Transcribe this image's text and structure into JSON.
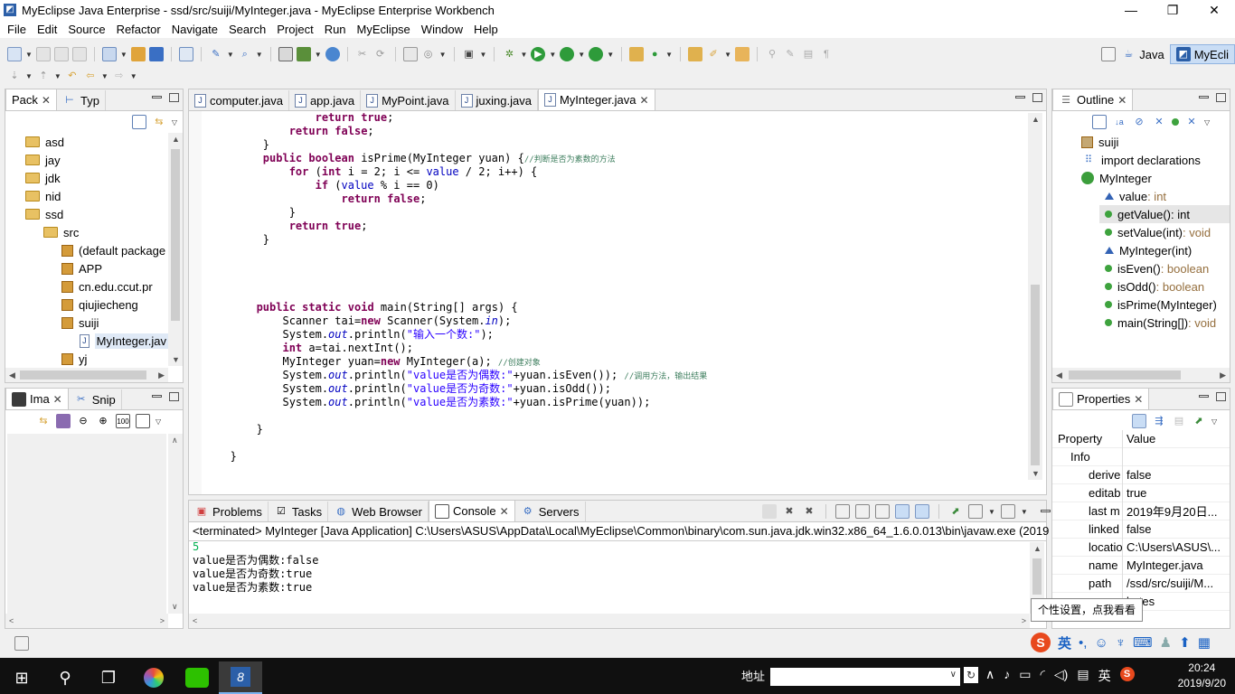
{
  "window": {
    "title": "MyEclipse Java Enterprise - ssd/src/suiji/MyInteger.java - MyEclipse Enterprise Workbench",
    "minimize": "—",
    "maximize": "❐",
    "close": "✕"
  },
  "menu": [
    "File",
    "Edit",
    "Source",
    "Refactor",
    "Navigate",
    "Search",
    "Project",
    "Run",
    "MyEclipse",
    "Window",
    "Help"
  ],
  "perspectives": [
    {
      "label": "Java",
      "active": false
    },
    {
      "label": "MyEcli",
      "active": true
    }
  ],
  "package_explorer": {
    "tabs": [
      {
        "label": "Pack",
        "active": true
      },
      {
        "label": "Typ",
        "active": false
      }
    ],
    "tree": [
      {
        "label": "asd",
        "indent": 0,
        "icon": "folder-icon"
      },
      {
        "label": "jay",
        "indent": 0,
        "icon": "folder-icon"
      },
      {
        "label": "jdk",
        "indent": 0,
        "icon": "folder-icon"
      },
      {
        "label": "nid",
        "indent": 0,
        "icon": "folder-icon"
      },
      {
        "label": "ssd",
        "indent": 0,
        "icon": "folder-icon"
      },
      {
        "label": "src",
        "indent": 1,
        "icon": "folder-icon"
      },
      {
        "label": "(default package",
        "indent": 2,
        "icon": "package-icon"
      },
      {
        "label": "APP",
        "indent": 2,
        "icon": "package-icon"
      },
      {
        "label": "cn.edu.ccut.pr",
        "indent": 2,
        "icon": "package-icon"
      },
      {
        "label": "qiujiecheng",
        "indent": 2,
        "icon": "package-icon"
      },
      {
        "label": "suiji",
        "indent": 2,
        "icon": "package-icon"
      },
      {
        "label": "MyInteger.jav",
        "indent": 3,
        "icon": "java-file-icon",
        "selected": true
      },
      {
        "label": "yj",
        "indent": 2,
        "icon": "package-icon"
      }
    ]
  },
  "image_view": {
    "tabs": [
      {
        "label": "Ima",
        "active": true
      },
      {
        "label": "Snip",
        "active": false
      }
    ]
  },
  "editor": {
    "tabs": [
      {
        "label": "computer.java",
        "active": false
      },
      {
        "label": "app.java",
        "active": false
      },
      {
        "label": "MyPoint.java",
        "active": false
      },
      {
        "label": "juxing.java",
        "active": false
      },
      {
        "label": "MyInteger.java",
        "active": true
      }
    ],
    "comments": {
      "prime": "//判断是否为素数的方法",
      "create": "//创建对象",
      "call": "//调用方法，输出结果"
    },
    "strings": {
      "prompt": "\"输入一个数:\"",
      "even": "\"value是否为偶数:\"",
      "odd": "\"value是否为奇数:\"",
      "prime": "\"value是否为素数:\""
    }
  },
  "bottom_panel": {
    "tabs": [
      {
        "label": "Problems",
        "active": false
      },
      {
        "label": "Tasks",
        "active": false
      },
      {
        "label": "Web Browser",
        "active": false
      },
      {
        "label": "Console",
        "active": true
      },
      {
        "label": "Servers",
        "active": false
      }
    ],
    "terminated": "<terminated> MyInteger [Java Application] C:\\Users\\ASUS\\AppData\\Local\\MyEclipse\\Common\\binary\\com.sun.java.jdk.win32.x86_64_1.6.0.013\\bin\\javaw.exe (2019",
    "output": [
      {
        "text": "5",
        "input": true
      },
      {
        "text": "value是否为偶数:false",
        "input": false
      },
      {
        "text": "value是否为奇数:true",
        "input": false
      },
      {
        "text": "value是否为素数:true",
        "input": false
      }
    ]
  },
  "outline": {
    "tab": "Outline",
    "items": [
      {
        "name": "suiji",
        "type": "",
        "indent": 0,
        "icon": "package-icon"
      },
      {
        "name": "import declarations",
        "type": "",
        "indent": 0,
        "icon": "imports-icon"
      },
      {
        "name": "MyInteger",
        "type": "",
        "indent": 0,
        "icon": "class-icon"
      },
      {
        "name": "value",
        "type": " : int",
        "indent": 1,
        "icon": "field-icon"
      },
      {
        "name": "getValue()",
        "type": " : int",
        "indent": 1,
        "icon": "method-icon",
        "selected": true
      },
      {
        "name": "setValue(int)",
        "type": " : void",
        "indent": 1,
        "icon": "method-icon"
      },
      {
        "name": "MyInteger(int)",
        "type": "",
        "indent": 1,
        "icon": "constructor-icon",
        "marker": "c"
      },
      {
        "name": "isEven()",
        "type": " : boolean",
        "indent": 1,
        "icon": "method-icon"
      },
      {
        "name": "isOdd()",
        "type": " : boolean",
        "indent": 1,
        "icon": "method-icon"
      },
      {
        "name": "isPrime(MyInteger)",
        "type": "",
        "indent": 1,
        "icon": "method-icon"
      },
      {
        "name": "main(String[])",
        "type": " : void",
        "indent": 1,
        "icon": "method-icon",
        "marker": "S"
      }
    ]
  },
  "properties": {
    "tab": "Properties",
    "col_property": "Property",
    "col_value": "Value",
    "category": "Info",
    "rows": [
      {
        "k": "derive",
        "v": "false"
      },
      {
        "k": "editab",
        "v": "true"
      },
      {
        "k": "last m",
        "v": "2019年9月20日..."
      },
      {
        "k": "linked",
        "v": "false"
      },
      {
        "k": "locatio",
        "v": "C:\\Users\\ASUS\\..."
      },
      {
        "k": "name",
        "v": "MyInteger.java"
      },
      {
        "k": "path",
        "v": "/ssd/src/suiji/M..."
      },
      {
        "k": "",
        "v": "bytes"
      }
    ]
  },
  "tooltip": "个性设置，点我看看",
  "ime": {
    "lang": "英",
    "punct": "•,"
  },
  "taskbar": {
    "address_label": "地址",
    "address_value": "",
    "ime_lang": "英",
    "time": "20:24",
    "date": "2019/9/20"
  }
}
